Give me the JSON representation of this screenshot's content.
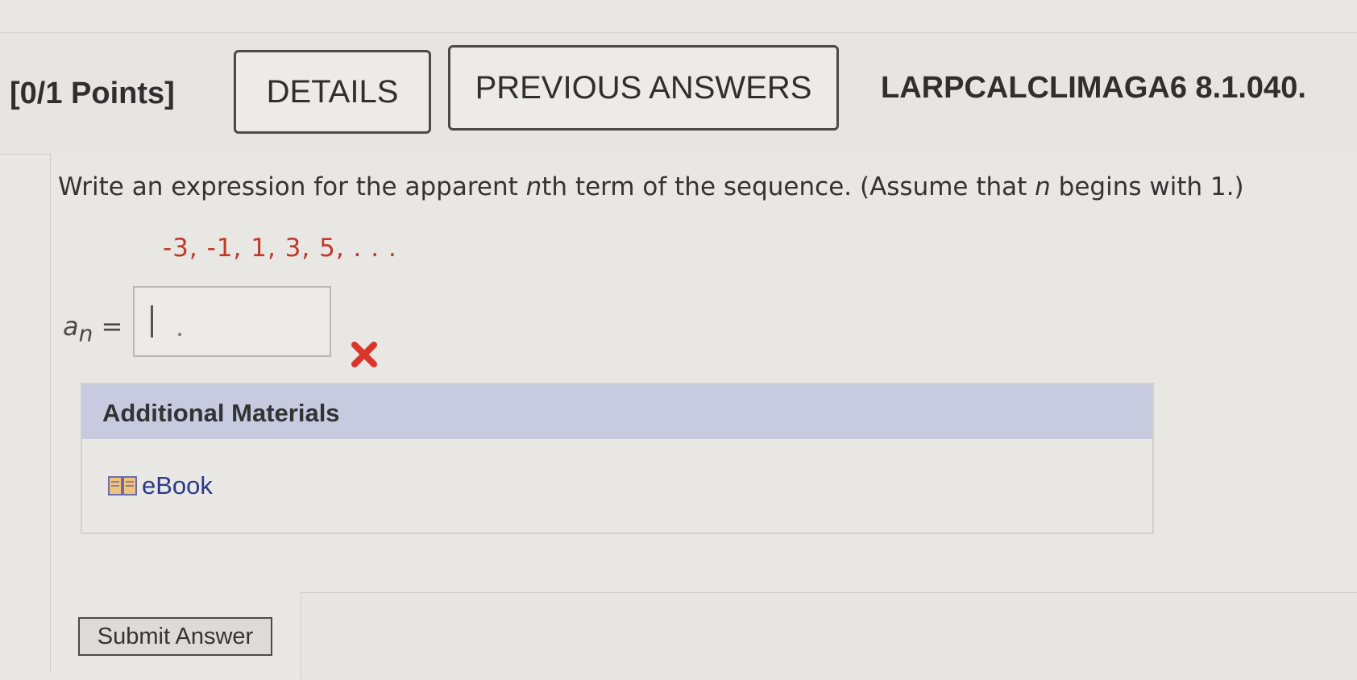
{
  "header": {
    "points": "[0/1 Points]",
    "details_label": "DETAILS",
    "previous_answers_label": "PREVIOUS ANSWERS",
    "problem_id": "LARPCALCLIMAGA6 8.1.040."
  },
  "question": {
    "text_part1": "Write an expression for the apparent ",
    "italic_n1": "n",
    "text_part2": "th term of the sequence. (Assume that ",
    "italic_n2": "n",
    "text_part3": " begins with 1.)",
    "sequence": "-3, -1, 1, 3, 5, . . .",
    "answer_label_a": "a",
    "answer_label_sub": "n",
    "answer_label_eq": " =",
    "answer_value": "",
    "answer_status": "incorrect"
  },
  "materials": {
    "title": "Additional Materials",
    "ebook_label": "eBook"
  },
  "submit": {
    "label": "Submit Answer"
  },
  "colors": {
    "sequence_text": "#c1392b",
    "wrong_mark": "#d9362b",
    "materials_header_bg": "#c8cbe0",
    "link": "#2a3a8a"
  },
  "icons": {
    "wrong": "close-icon",
    "ebook": "book-icon"
  }
}
